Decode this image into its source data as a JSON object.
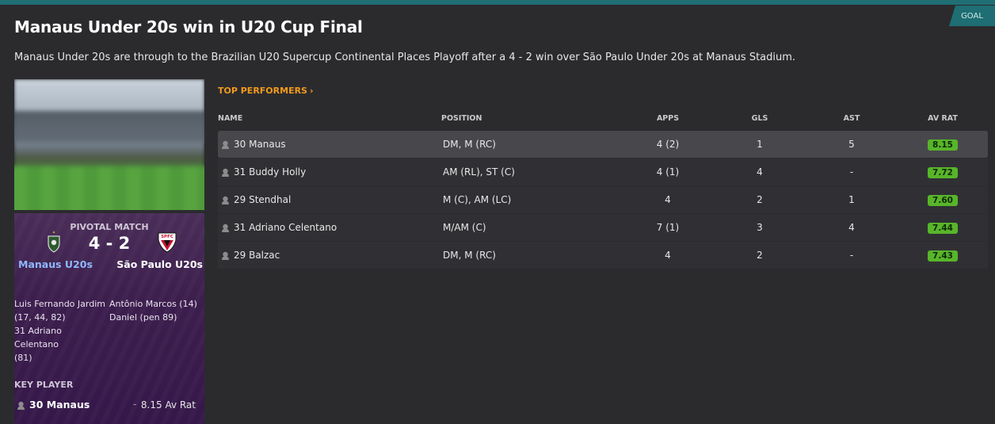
{
  "header": {
    "tag": "GOAL",
    "title": "Manaus Under 20s win in U20 Cup Final",
    "summary": "Manaus Under 20s are through to the Brazilian U20 Supercup Continental Places Playoff after a 4 - 2 win over São Paulo Under 20s at Manaus Stadium."
  },
  "pivotal_match": {
    "label": "PIVOTAL MATCH",
    "score": "4 - 2",
    "home_team": "Manaus U20s",
    "away_team": "São Paulo U20s",
    "home_crest_text": "",
    "away_crest_text": "SPFC",
    "home_scorers": [
      "Luis Fernando Jardim",
      "(17, 44, 82)",
      "31 Adriano Celentano",
      "(81)"
    ],
    "away_scorers": [
      "Antônio Marcos (14)",
      "Daniel (pen 89)"
    ],
    "key_player_label": "KEY PLAYER",
    "key_player_name": "30 Manaus",
    "key_player_dash": "-",
    "key_player_rating": "8.15 Av Rat"
  },
  "top_performers": {
    "link_label": "TOP PERFORMERS",
    "chevron": "›",
    "columns": {
      "name": "NAME",
      "position": "POSITION",
      "apps": "APPS",
      "gls": "GLS",
      "ast": "AST",
      "av_rat": "AV RAT"
    },
    "rows": [
      {
        "name": "30 Manaus",
        "position": "DM, M (RC)",
        "apps": "4 (2)",
        "gls": "1",
        "ast": "5",
        "av_rat": "8.15"
      },
      {
        "name": "31 Buddy Holly",
        "position": "AM (RL), ST (C)",
        "apps": "4 (1)",
        "gls": "4",
        "ast": "-",
        "av_rat": "7.72"
      },
      {
        "name": "29 Stendhal",
        "position": "M (C), AM (LC)",
        "apps": "4",
        "gls": "2",
        "ast": "1",
        "av_rat": "7.60"
      },
      {
        "name": "31 Adriano Celentano",
        "position": "M/AM (C)",
        "apps": "7 (1)",
        "gls": "3",
        "ast": "4",
        "av_rat": "7.44"
      },
      {
        "name": "29 Balzac",
        "position": "DM, M (RC)",
        "apps": "4",
        "gls": "2",
        "ast": "-",
        "av_rat": "7.43"
      }
    ]
  },
  "colors": {
    "accent_teal": "#1f6f75",
    "link_orange": "#f29a1d",
    "rating_green": "#58b52a",
    "pivotal_purple": "#3d1f4e",
    "home_team_blue": "#8fb8ff"
  },
  "icons": {
    "person": "person-icon",
    "home_crest": "manaus-crest-icon",
    "away_crest": "sao-paulo-crest-icon"
  }
}
